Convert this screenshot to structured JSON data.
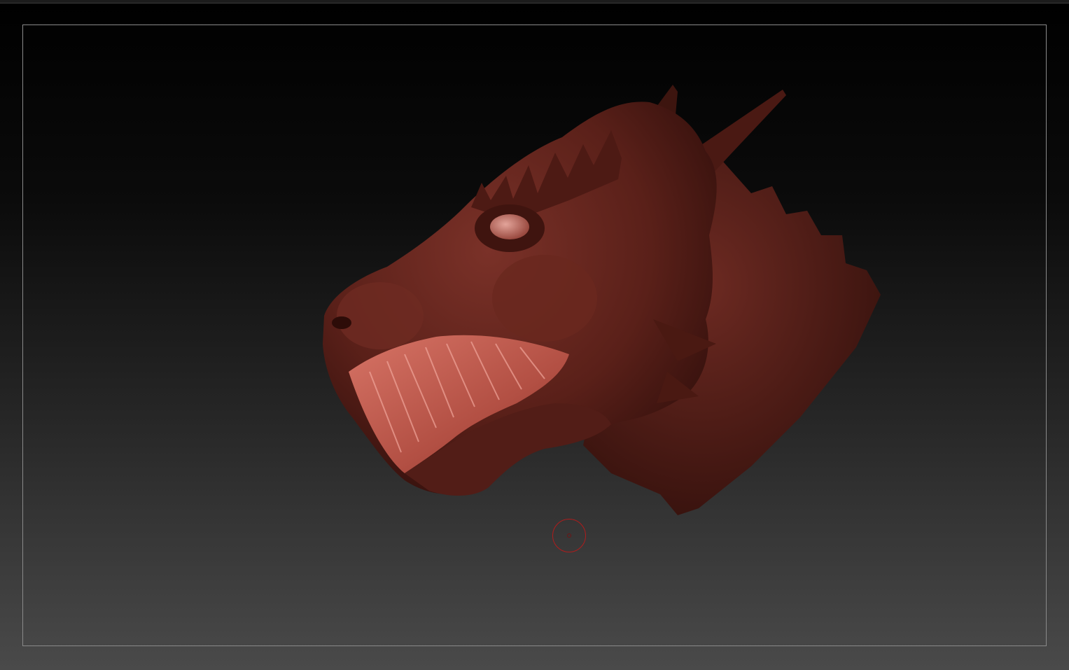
{
  "viewport": {
    "background_top_color": "#000000",
    "background_bottom_color": "#4a4a4a",
    "frame_color": "#8a8a8a"
  },
  "model": {
    "icon": "dragon-head-sculpt",
    "material_color": "#5e231d",
    "highlight_color": "#b9564a",
    "mouth_color": "#c9655a"
  },
  "cursor": {
    "icon": "brush-circle-icon",
    "color": "#b01c1c"
  }
}
